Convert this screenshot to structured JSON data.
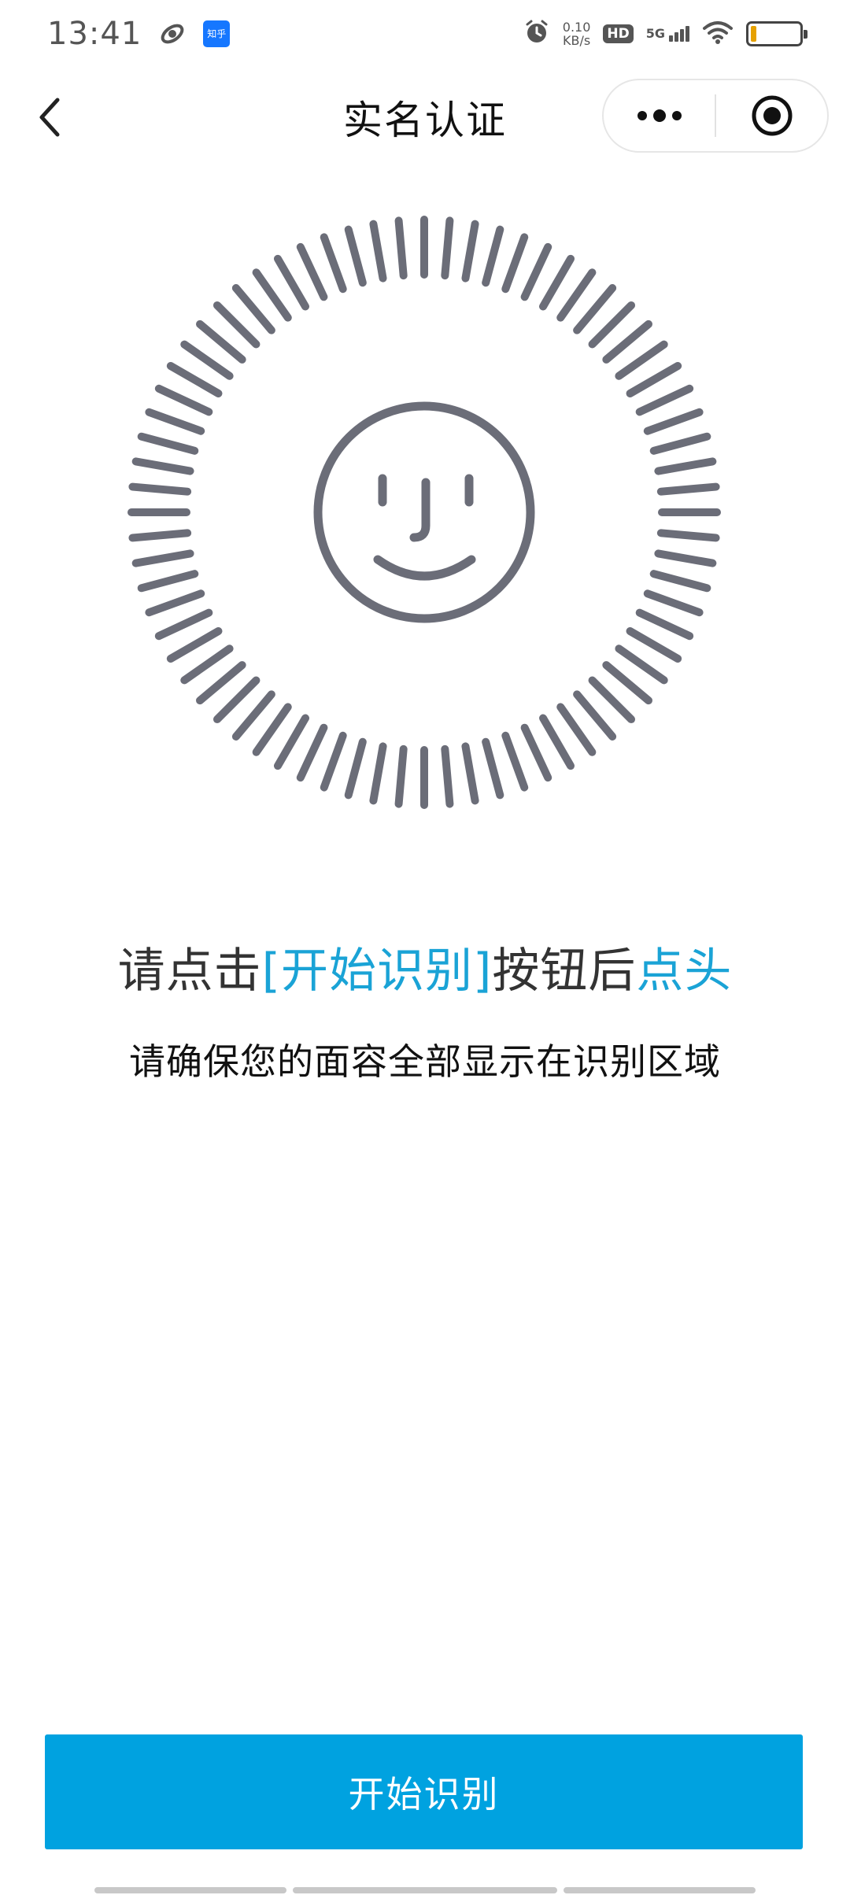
{
  "status_bar": {
    "time": "13:41",
    "zhihu_label": "知乎",
    "speed_value": "0.10",
    "speed_unit": "KB/s",
    "hd_label": "HD",
    "network_label": "5G",
    "battery_level": 0.12,
    "battery_color": "#e6a100"
  },
  "nav": {
    "title": "实名认证",
    "back_icon": "chevron-left-icon",
    "menu_icon": "more-dots-icon",
    "close_icon": "target-close-icon"
  },
  "scan": {
    "tick_count": 72,
    "tick_color": "#6b6d78",
    "face_icon": "smiley-face-icon"
  },
  "instruction": {
    "prefix": "请点击",
    "action": "[开始识别]",
    "middle": "按钮后",
    "gesture": "点头",
    "highlight_color": "#1aa3d6"
  },
  "sub_instruction": "请确保您的面容全部显示在识别区域",
  "start_button": {
    "label": "开始识别",
    "color": "#00a2e0"
  }
}
